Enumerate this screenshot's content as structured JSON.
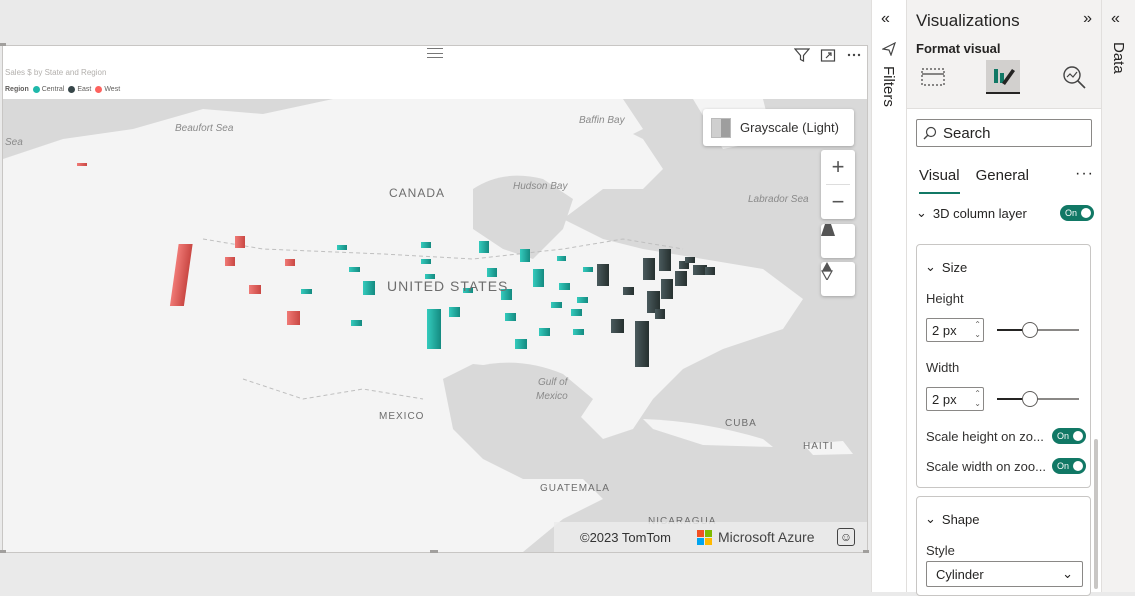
{
  "visual": {
    "title": "Sales $ by State and Region",
    "legend": {
      "title": "Region",
      "items": [
        {
          "label": "Central",
          "color": "#1fb8aa"
        },
        {
          "label": "East",
          "color": "#374649"
        },
        {
          "label": "West",
          "color": "#fd625e"
        }
      ]
    },
    "map": {
      "style_label": "Grayscale (Light)",
      "labels": {
        "canada": "CANADA",
        "united_states": "UNITED STATES",
        "mexico": "MEXICO",
        "cuba": "CUBA",
        "haiti": "HAITI",
        "guatemala": "GUATEMALA",
        "nicaragua": "NICARAGUA",
        "beaufort_sea": "Beaufort Sea",
        "baffin_bay": "Baffin Bay",
        "hudson_bay": "Hudson Bay",
        "labrador_sea": "Labrador Sea",
        "gulf_of_mexico_1": "Gulf of",
        "gulf_of_mexico_2": "Mexico",
        "sea": "Sea"
      },
      "attribution": "©2023 TomTom",
      "provider": "Microsoft Azure"
    }
  },
  "filters_pane": {
    "label": "Filters"
  },
  "viz_pane": {
    "title": "Visualizations",
    "format_label": "Format visual",
    "search_placeholder": "Search",
    "tabs": [
      "Visual",
      "General"
    ],
    "more": "···",
    "layer": {
      "label": "3D column layer",
      "toggle": "On"
    },
    "size": {
      "label": "Size",
      "height_label": "Height",
      "height_value": "2 px",
      "height_level": 0.4,
      "width_label": "Width",
      "width_value": "2 px",
      "width_level": 0.4,
      "scale_height_label": "Scale height on zo...",
      "scale_height_toggle": "On",
      "scale_width_label": "Scale width on zoo...",
      "scale_width_toggle": "On"
    },
    "shape": {
      "label": "Shape",
      "style_label": "Style",
      "style_value": "Cylinder"
    }
  },
  "data_pane": {
    "label": "Data"
  }
}
